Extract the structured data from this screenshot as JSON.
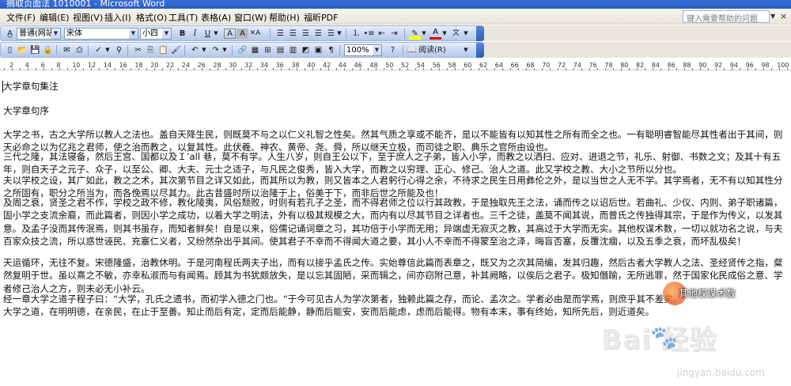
{
  "window": {
    "title": "摘取页面法 1010001 - Microsoft Word"
  },
  "menubar": {
    "items": [
      "文件(F)",
      "编辑(E)",
      "视图(V)",
      "插入(I)",
      "格式(O)",
      "工具(T)",
      "表格(A)",
      "窗口(W)",
      "帮助(H)",
      "福昕PDF"
    ],
    "help_placeholder": "键入需要帮助的问题",
    "close_glyph": "×"
  },
  "format_toolbar": {
    "style_value": "普通(网站)",
    "font_value": "宋体",
    "size_value": "小四",
    "bold": "B",
    "italic": "I",
    "underline": "U",
    "font_color_letter": "A",
    "highlight_letter": "A",
    "ab_label": "ab"
  },
  "standard_toolbar": {
    "zoom_value": "100%",
    "read_label": "阅读(R)"
  },
  "ruler": {
    "numbers": [
      "2",
      "4",
      "6",
      "8",
      "10",
      "12",
      "14",
      "16",
      "18",
      "20",
      "22",
      "24",
      "26",
      "28",
      "30",
      "32",
      "34",
      "36",
      "38",
      "40",
      "42",
      "44",
      "46",
      "48",
      "50",
      "52",
      "54",
      "56",
      "58",
      "60",
      "62",
      "64",
      "66",
      "68",
      "70",
      "72",
      "74",
      "76",
      "78",
      "80",
      "82",
      "84",
      "86",
      "88",
      "90",
      "92",
      "94",
      "96",
      "98",
      "100"
    ]
  },
  "document": {
    "paragraphs": [
      "大学章句集注",
      "大学章句序",
      "大学之书，古之大学所以教人之法也。盖自天降生民，则既莫不与之以仁义礼智之性矣。然其气质之享或不能齐，是以不能皆有以知其性之所有而全之也。一有聪明睿智能尽其性者出于其间，则天必命之以为亿兆之君师，使之治而教之，以复其性。此伏羲、神农、黄帝、尧、舜，所以继天立极，而司徒之职、典乐之官所由设也。",
      "三代之隆，其法寝备，然后王宫、国都以及Ｉ’all 巷，莫不有学。人生八岁，则自王公以下，至于庶人之子弟，皆入小学，而教之以洒扫、应对、进退之节，礼乐、射御、书数之文；及其十有五年，则自天子之元子、众子，以至公、卿、大夫、元士之适子，与凡民之俊秀，皆入大学，而教之以穷理、正心、修己、治人之道。此又学校之教、大小之节所以分也。",
      "夫以学校之设，其广如此，教之之术，其次第节目之详又如此，而其所以为教，则又皆本之人君躬行心得之余，不待求之民生日用彝伦之外，是以当世之人无不学。其学焉者，无不有以知其性分之所固有，职分之所当为，而各俛焉以尽其力。此古昔盛时所以治隆于上，俗美于下，而非后世之所能及也！",
      "及周之衰，贤圣之君不作，学校之政不修，教化陵夷，风俗颓败，时则有若孔子之圣，而不得君师之位以行其政教，于是独取先王之法，诵而传之以诏后世。若曲礼、少仪、内则、弟子职诸篇，固小学之支流余裔，而此篇者，则因小学之成功，以着大学之明法，外有以极其规模之大，而内有以尽其节目之详者也。三千之徒，盖莫不闻其说，而曾氏之传独得其宗，于是作为传义，以发其意。及孟子没而其传泯焉，则其书虽存，而知者鲜矣！自是以来，俗儒记诵词章之习，其功倍于小学而无用；异端虚无寂灭之教，其高过于大学而无实。其他权谋术数，一切以就功名之说，与夫百家众技之流，所以惑世诬民、充塞仁义者，又纷然杂出乎其间。使其君子不幸而不得闻大道之要，其小人不幸而不得蒙至治之泽，晦盲否塞，反覆沈痼，以及五季之衰，而坏乱极矣！",
      "天运循环，无往不复。宋德隆盛，治教休明。于是河南程氏两夫子出，而有以接乎孟氏之传。实始尊信此篇而表章之，既又为之次其简编，发其归趣，然后古者大学教人之法、圣经贤传之指，粲然复明于世。虽以熹之不敏，亦幸私淑而与有闻焉。顾其为书犹颇放失，是以忘其固陋，采而辑之，间亦窃附己意，补其阙略，以俟后之君子。极知僭踰，无所逃罪，然于国家化民成俗之意、学者修己治人之方，则未必无小补云。",
      "经一章大学之道子程子曰：“大学，孔氏之遗书，而初学入德之门也。“于今可见古人为学次第者，独赖此篇之存，而论、孟次之。学者必由是而学焉，则庶乎其不差矣。",
      "大学之道，在明明德，在亲民，在止于至善。知止而后有定，定而后能静，静而后能安，安而后能虑，虑而后能得。物有本末，事有终始，知所先后，则近道矣。"
    ]
  },
  "watermarks": {
    "badge_text": "其他权谋术数",
    "baidu_logo": "Bai 经验",
    "baidu_paw": "du",
    "baidu_url": "jingyan.baidu.com"
  }
}
